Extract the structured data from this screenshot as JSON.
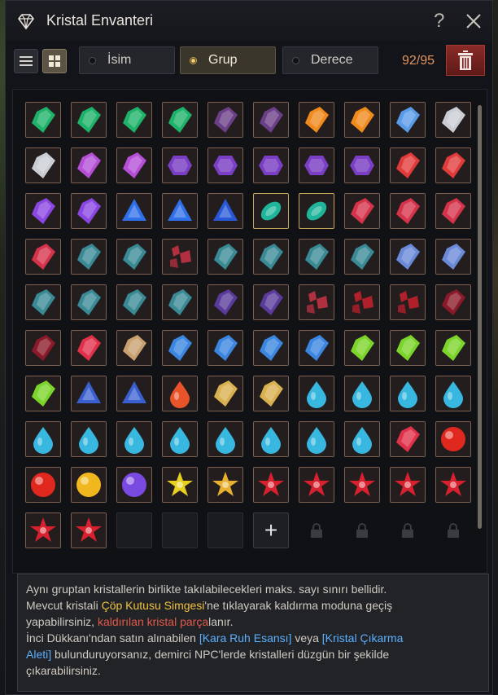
{
  "window": {
    "title": "Kristal Envanteri"
  },
  "toolbar": {
    "sort_buttons": [
      {
        "label": "İsim",
        "active": false
      },
      {
        "label": "Grup",
        "active": true
      },
      {
        "label": "Derece",
        "active": false
      }
    ],
    "count": "92/95"
  },
  "grid": {
    "rows": [
      [
        "green",
        "green",
        "green",
        "green",
        "dark-purple",
        "dark-purple",
        "orange",
        "orange",
        "rainbow",
        "silver"
      ],
      [
        "silver",
        "magenta",
        "magenta",
        "violet-hex",
        "violet-hex",
        "violet-hex",
        "violet-hex",
        "violet-hex",
        "red-shard",
        "red-shard"
      ],
      [
        "purple-shard",
        "purple-shard",
        "blue-trillion",
        "blue-trillion",
        "blue-heart",
        "teal-marquise",
        "teal-marquise",
        "crimson-gem",
        "crimson-gem",
        "crimson-gem"
      ],
      [
        "crimson-gem",
        "dark-teal",
        "dark-teal",
        "shard-cluster",
        "dark-teal",
        "dark-teal",
        "dark-teal",
        "dark-teal",
        "sky-shard",
        "sky-shard"
      ],
      [
        "dark-teal",
        "dark-teal",
        "dark-teal",
        "dark-teal",
        "dark-violet",
        "dark-violet",
        "shard-cluster",
        "red-cluster",
        "red-cluster",
        "dark-ruby"
      ],
      [
        "dark-ruby",
        "ruby-shard",
        "amber-shard",
        "blue-gem",
        "blue-gem",
        "blue-gem",
        "blue-gem",
        "lime-gem",
        "lime-gem",
        "lime-gem"
      ],
      [
        "lime-gem",
        "blue-round",
        "blue-round",
        "flame-drop",
        "topaz-shard",
        "topaz-shard",
        "aqua-drop",
        "aqua-drop",
        "aqua-drop",
        "aqua-drop"
      ],
      [
        "aqua-drop",
        "aqua-drop",
        "aqua-drop",
        "aqua-drop",
        "aqua-drop",
        "aqua-drop",
        "aqua-drop",
        "aqua-drop",
        "ruby-shard",
        "red-orb"
      ],
      [
        "red-orb",
        "gold-orb",
        "violet-orb",
        "yellow-star",
        "gold-star",
        "red-flower",
        "red-flower",
        "red-flower",
        "red-flower",
        "red-flower"
      ],
      [
        "red-flower",
        "red-flower",
        "empty",
        "empty",
        "empty",
        "add",
        "locked",
        "locked",
        "locked",
        "locked"
      ]
    ]
  },
  "colors": {
    "green": "#1fb36a",
    "dark-purple": "#6b3f86",
    "orange": "#f08a1c",
    "rainbow": "#5a9be8",
    "silver": "#c9cdd3",
    "magenta": "#b44fd6",
    "violet-hex": "#7a3fc4",
    "red-shard": "#e13a3a",
    "purple-shard": "#8a46e0",
    "blue-trillion": "#2f6fe8",
    "blue-heart": "#2858d8",
    "teal-marquise": "#1fb59a",
    "crimson-gem": "#d4334a",
    "dark-teal": "#3a8a96",
    "shard-cluster": "#b03040",
    "sky-shard": "#6a8ad8",
    "dark-violet": "#5a3a9a",
    "red-cluster": "#b0202a",
    "dark-ruby": "#8a1a2a",
    "ruby-shard": "#e0304a",
    "amber-shard": "#c9a070",
    "blue-gem": "#3a86e0",
    "lime-gem": "#7ad42a",
    "blue-round": "#3a60d0",
    "flame-drop": "#e8542a",
    "topaz-shard": "#d8b050",
    "aqua-drop": "#38b8e0",
    "red-orb": "#e0281e",
    "gold-orb": "#f0b81e",
    "violet-orb": "#7a4ae0",
    "yellow-star": "#e8d020",
    "gold-star": "#e8b030",
    "red-flower": "#d8202e"
  },
  "tooltip": {
    "line1": "Aynı gruptan kristallerin birlikte takılabilecekleri maks. sayı sınırı bellidir.",
    "line2_a": "Mevcut kristali ",
    "line2_hl": "Çöp Kutusu Simgesi",
    "line2_b": "'ne tıklayarak kaldırma moduna geçiş",
    "line3_a": "yapabilirsiniz, ",
    "line3_hl": "kaldırılan kristal parça",
    "line3_b": "lanır.",
    "line4_a": "İnci Dükkanı'ndan satın alınabilen ",
    "line4_hl1": "[Kara Ruh Esansı]",
    "line4_b": " veya ",
    "line4_hl2": "[Kristal Çıkarma",
    "line5_hl": "Aleti]",
    "line5_b": " bulunduruyorsanız, demirci NPC'lerde kristalleri düzgün bir şekilde",
    "line6": "çıkarabilirsiniz."
  }
}
